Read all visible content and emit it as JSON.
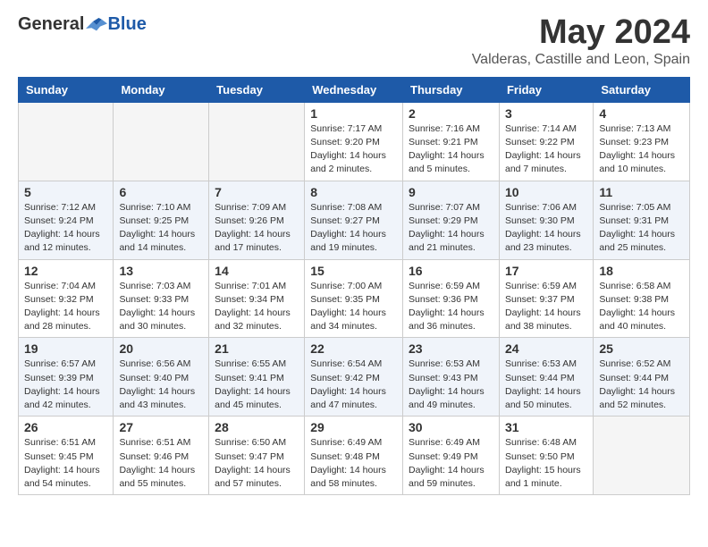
{
  "header": {
    "logo_general": "General",
    "logo_blue": "Blue",
    "month_title": "May 2024",
    "location": "Valderas, Castille and Leon, Spain"
  },
  "weekdays": [
    "Sunday",
    "Monday",
    "Tuesday",
    "Wednesday",
    "Thursday",
    "Friday",
    "Saturday"
  ],
  "weeks": [
    [
      {
        "day": "",
        "info": ""
      },
      {
        "day": "",
        "info": ""
      },
      {
        "day": "",
        "info": ""
      },
      {
        "day": "1",
        "info": "Sunrise: 7:17 AM\nSunset: 9:20 PM\nDaylight: 14 hours\nand 2 minutes."
      },
      {
        "day": "2",
        "info": "Sunrise: 7:16 AM\nSunset: 9:21 PM\nDaylight: 14 hours\nand 5 minutes."
      },
      {
        "day": "3",
        "info": "Sunrise: 7:14 AM\nSunset: 9:22 PM\nDaylight: 14 hours\nand 7 minutes."
      },
      {
        "day": "4",
        "info": "Sunrise: 7:13 AM\nSunset: 9:23 PM\nDaylight: 14 hours\nand 10 minutes."
      }
    ],
    [
      {
        "day": "5",
        "info": "Sunrise: 7:12 AM\nSunset: 9:24 PM\nDaylight: 14 hours\nand 12 minutes."
      },
      {
        "day": "6",
        "info": "Sunrise: 7:10 AM\nSunset: 9:25 PM\nDaylight: 14 hours\nand 14 minutes."
      },
      {
        "day": "7",
        "info": "Sunrise: 7:09 AM\nSunset: 9:26 PM\nDaylight: 14 hours\nand 17 minutes."
      },
      {
        "day": "8",
        "info": "Sunrise: 7:08 AM\nSunset: 9:27 PM\nDaylight: 14 hours\nand 19 minutes."
      },
      {
        "day": "9",
        "info": "Sunrise: 7:07 AM\nSunset: 9:29 PM\nDaylight: 14 hours\nand 21 minutes."
      },
      {
        "day": "10",
        "info": "Sunrise: 7:06 AM\nSunset: 9:30 PM\nDaylight: 14 hours\nand 23 minutes."
      },
      {
        "day": "11",
        "info": "Sunrise: 7:05 AM\nSunset: 9:31 PM\nDaylight: 14 hours\nand 25 minutes."
      }
    ],
    [
      {
        "day": "12",
        "info": "Sunrise: 7:04 AM\nSunset: 9:32 PM\nDaylight: 14 hours\nand 28 minutes."
      },
      {
        "day": "13",
        "info": "Sunrise: 7:03 AM\nSunset: 9:33 PM\nDaylight: 14 hours\nand 30 minutes."
      },
      {
        "day": "14",
        "info": "Sunrise: 7:01 AM\nSunset: 9:34 PM\nDaylight: 14 hours\nand 32 minutes."
      },
      {
        "day": "15",
        "info": "Sunrise: 7:00 AM\nSunset: 9:35 PM\nDaylight: 14 hours\nand 34 minutes."
      },
      {
        "day": "16",
        "info": "Sunrise: 6:59 AM\nSunset: 9:36 PM\nDaylight: 14 hours\nand 36 minutes."
      },
      {
        "day": "17",
        "info": "Sunrise: 6:59 AM\nSunset: 9:37 PM\nDaylight: 14 hours\nand 38 minutes."
      },
      {
        "day": "18",
        "info": "Sunrise: 6:58 AM\nSunset: 9:38 PM\nDaylight: 14 hours\nand 40 minutes."
      }
    ],
    [
      {
        "day": "19",
        "info": "Sunrise: 6:57 AM\nSunset: 9:39 PM\nDaylight: 14 hours\nand 42 minutes."
      },
      {
        "day": "20",
        "info": "Sunrise: 6:56 AM\nSunset: 9:40 PM\nDaylight: 14 hours\nand 43 minutes."
      },
      {
        "day": "21",
        "info": "Sunrise: 6:55 AM\nSunset: 9:41 PM\nDaylight: 14 hours\nand 45 minutes."
      },
      {
        "day": "22",
        "info": "Sunrise: 6:54 AM\nSunset: 9:42 PM\nDaylight: 14 hours\nand 47 minutes."
      },
      {
        "day": "23",
        "info": "Sunrise: 6:53 AM\nSunset: 9:43 PM\nDaylight: 14 hours\nand 49 minutes."
      },
      {
        "day": "24",
        "info": "Sunrise: 6:53 AM\nSunset: 9:44 PM\nDaylight: 14 hours\nand 50 minutes."
      },
      {
        "day": "25",
        "info": "Sunrise: 6:52 AM\nSunset: 9:44 PM\nDaylight: 14 hours\nand 52 minutes."
      }
    ],
    [
      {
        "day": "26",
        "info": "Sunrise: 6:51 AM\nSunset: 9:45 PM\nDaylight: 14 hours\nand 54 minutes."
      },
      {
        "day": "27",
        "info": "Sunrise: 6:51 AM\nSunset: 9:46 PM\nDaylight: 14 hours\nand 55 minutes."
      },
      {
        "day": "28",
        "info": "Sunrise: 6:50 AM\nSunset: 9:47 PM\nDaylight: 14 hours\nand 57 minutes."
      },
      {
        "day": "29",
        "info": "Sunrise: 6:49 AM\nSunset: 9:48 PM\nDaylight: 14 hours\nand 58 minutes."
      },
      {
        "day": "30",
        "info": "Sunrise: 6:49 AM\nSunset: 9:49 PM\nDaylight: 14 hours\nand 59 minutes."
      },
      {
        "day": "31",
        "info": "Sunrise: 6:48 AM\nSunset: 9:50 PM\nDaylight: 15 hours\nand 1 minute."
      },
      {
        "day": "",
        "info": ""
      }
    ]
  ]
}
